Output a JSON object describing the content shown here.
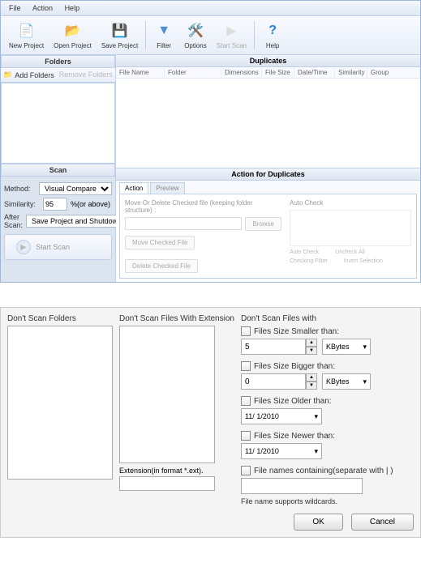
{
  "menu": {
    "file": "File",
    "action": "Action",
    "help": "Help"
  },
  "toolbar": {
    "newproject": "New Project",
    "openproject": "Open Project",
    "saveproject": "Save Project",
    "filter": "Filter",
    "options": "Options",
    "startscan": "Start Scan",
    "help": "Help"
  },
  "folders": {
    "title": "Folders",
    "add": "Add Folders",
    "remove": "Remove Folders"
  },
  "scan": {
    "title": "Scan",
    "method_label": "Method:",
    "method": "Visual Compare",
    "similarity_label": "Similarity:",
    "similarity": "95",
    "similarity_suffix": "%(or above)",
    "afterscan_label": "After Scan:",
    "afterscan": "Save Project and Shutdown",
    "start": "Start Scan"
  },
  "dup": {
    "title": "Duplicates",
    "cols": {
      "filename": "File Name",
      "folder": "Folder",
      "dimensions": "Dimensions",
      "filesize": "File Size",
      "datetime": "Date/Time",
      "similarity": "Similarity",
      "group": "Group"
    }
  },
  "actiondup": {
    "title": "Action for Duplicates",
    "tab_action": "Action",
    "tab_preview": "Preview",
    "move_label": "Move Or Delete Checked file (keeping folder structure) :",
    "browse": "Browse",
    "movechecked": "Move Checked File",
    "deletechecked": "Delete Checked File",
    "autocheck_label": "Auto Check",
    "autocheck": "Auto Check",
    "uncheckall": "Uncheck All",
    "checkingfilter": "Checking Filter",
    "invertsel": "Invert Selection"
  },
  "dialog": {
    "dontscanfolders": "Don't Scan Folders",
    "dontscanext": "Don't Scan Files With Extension",
    "extformat": "Extension(in format *.ext).",
    "dontscanfiles": "Don't Scan Files with",
    "smaller": "Files Size Smaller than:",
    "smaller_val": "5",
    "bigger": "Files Size Bigger than:",
    "bigger_val": "0",
    "older": "Files Size Older than:",
    "older_val": "11/  1/2010",
    "newer": "Files Size Newer than:",
    "newer_val": "11/  1/2010",
    "containing": "File names containing(separate with | )",
    "wildcards": "File name supports wildcards.",
    "unit": "KBytes",
    "ok": "OK",
    "cancel": "Cancel"
  }
}
